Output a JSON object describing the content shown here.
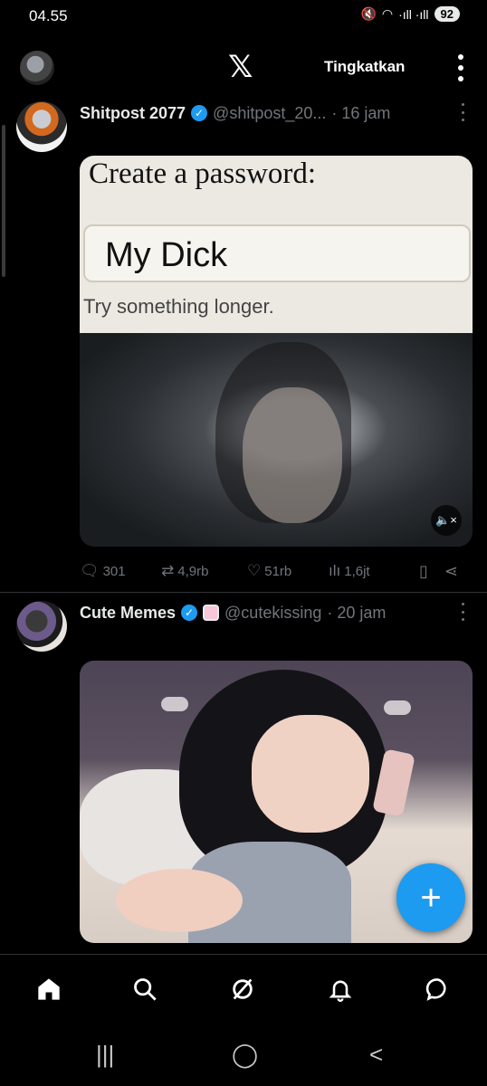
{
  "status_bar": {
    "time": "04.55",
    "signal_text": "·ıll ·ıll",
    "battery": "92"
  },
  "top_nav": {
    "upgrade_label": "Tingkatkan",
    "logo": "𝕏"
  },
  "posts": [
    {
      "display_name": "Shitpost 2077",
      "handle": "@shitpost_20...",
      "time": "· 16 jam",
      "verified": true,
      "media": {
        "title": "Create a password:",
        "field_value": "My Dick",
        "error_text": "Try something longer."
      },
      "actions": {
        "replies": "301",
        "reposts": "4,9rb",
        "likes": "51rb",
        "views": "1,6jt"
      }
    },
    {
      "display_name": "Cute Memes",
      "handle": "@cutekissing",
      "time": "· 20 jam",
      "verified": true
    }
  ],
  "icons": {
    "home": "home-icon",
    "search": "search-icon",
    "grok": "grok-icon",
    "notifications": "bell-icon",
    "messages": "messages-icon",
    "compose": "plus-icon"
  },
  "colors": {
    "accent": "#1d9bf0",
    "background": "#000000",
    "secondary_text": "#71767b"
  }
}
